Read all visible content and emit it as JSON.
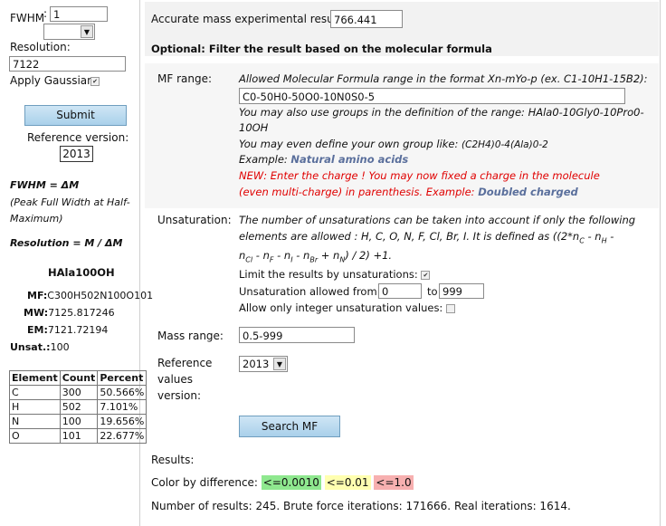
{
  "left": {
    "fwhm_label": "FWHM",
    "fwhm_value": "1",
    "resolution_label": "Resolution:",
    "resolution_value": "7122",
    "apply_gaussian_label": "Apply Gaussian:",
    "submit_label": "Submit",
    "reference_version_label": "Reference version:",
    "reference_version_value": "2013",
    "fwhm_def_line1": "FWHM = ΔM",
    "fwhm_def_line2": "(Peak Full Width at Half-",
    "fwhm_def_line3": "Maximum)",
    "resolution_def": "Resolution = M / ΔM",
    "compound_name": "HAla100OH",
    "mf_label": "MF:",
    "mf_value": "C300H502N100O101",
    "mw_label": "MW:",
    "mw_value": "7125.817246",
    "em_label": "EM:",
    "em_value": "7121.72194",
    "unsat_label": "Unsat.:",
    "unsat_value": "100",
    "table": {
      "headers": [
        "Element",
        "Count",
        "Percent"
      ],
      "rows": [
        [
          "C",
          "300",
          "50.566%"
        ],
        [
          "H",
          "502",
          "7.101%"
        ],
        [
          "N",
          "100",
          "19.656%"
        ],
        [
          "O",
          "101",
          "22.677%"
        ]
      ]
    }
  },
  "main": {
    "accurate_mass_label": "Accurate mass experimental result:",
    "accurate_mass_value": "766.441",
    "optional_heading": "Optional: Filter the result based on the molecular formula",
    "mf_range_label": "MF range:",
    "mf_range_desc": "Allowed Molecular Formula range in the format Xn-mYo-p (ex. C1-10H1-15B2):",
    "mf_range_value": "C0-50H0-50O0-10N0S0-5",
    "groups_line1": "You may also use groups in the definition of the range: HAla0-10Gly0-10Pro0-",
    "groups_line2": "10OH",
    "own_group_prefix": "You may even define your own group like: ",
    "own_group_example": "(C2H4)0-4(Ala)0-2",
    "example_label": "Example: ",
    "natural_amino_acids_link": "Natural amino acids",
    "new_line1": "NEW: Enter the charge ! You may now fixed a charge in the molecule",
    "new_line2": "(even multi-charge) in parenthesis. Example: ",
    "doubled_charged_link": "Doubled charged",
    "unsaturation_label": "Unsaturation:",
    "unsat_desc_line1": "The number of unsaturations can be taken into account if only the following",
    "unsat_desc_line2": "elements are allowed : H, C, O, N, F, Cl, Br, I. It is defined as ((2*n",
    "unsat_desc_line2b": " - n",
    "unsat_desc_line3": " - n",
    "unsat_desc_line3end": ") / 2) +1.",
    "limit_label": "Limit the results by unsaturations:",
    "unsat_from_label": "Unsaturation allowed from:",
    "unsat_from_value": "0",
    "unsat_to_label": "to",
    "unsat_to_value": "999",
    "integer_label": "Allow only integer unsaturation values:",
    "mass_range_label": "Mass range:",
    "mass_range_value": "0.5-999",
    "reference_label_1": "Reference",
    "reference_label_2": "values",
    "reference_label_3": "version:",
    "reference_select_value": "2013",
    "search_button_label": "Search MF",
    "results_label": "Results:",
    "color_by_diff_label": "Color by difference:",
    "legend_green": "<=0.0010",
    "legend_yellow": "<=0.01",
    "legend_pink": "<=1.0",
    "results_summary": "Number of results: 245. Brute force iterations: 171666. Real iterations: 1614."
  },
  "colors": {
    "green": "#8fe88f",
    "yellow": "#ffffb0",
    "pink": "#f7b0b0",
    "button_blue": "#a9d0ea",
    "new_red": "#e00000",
    "link": "#5a6f9c"
  }
}
